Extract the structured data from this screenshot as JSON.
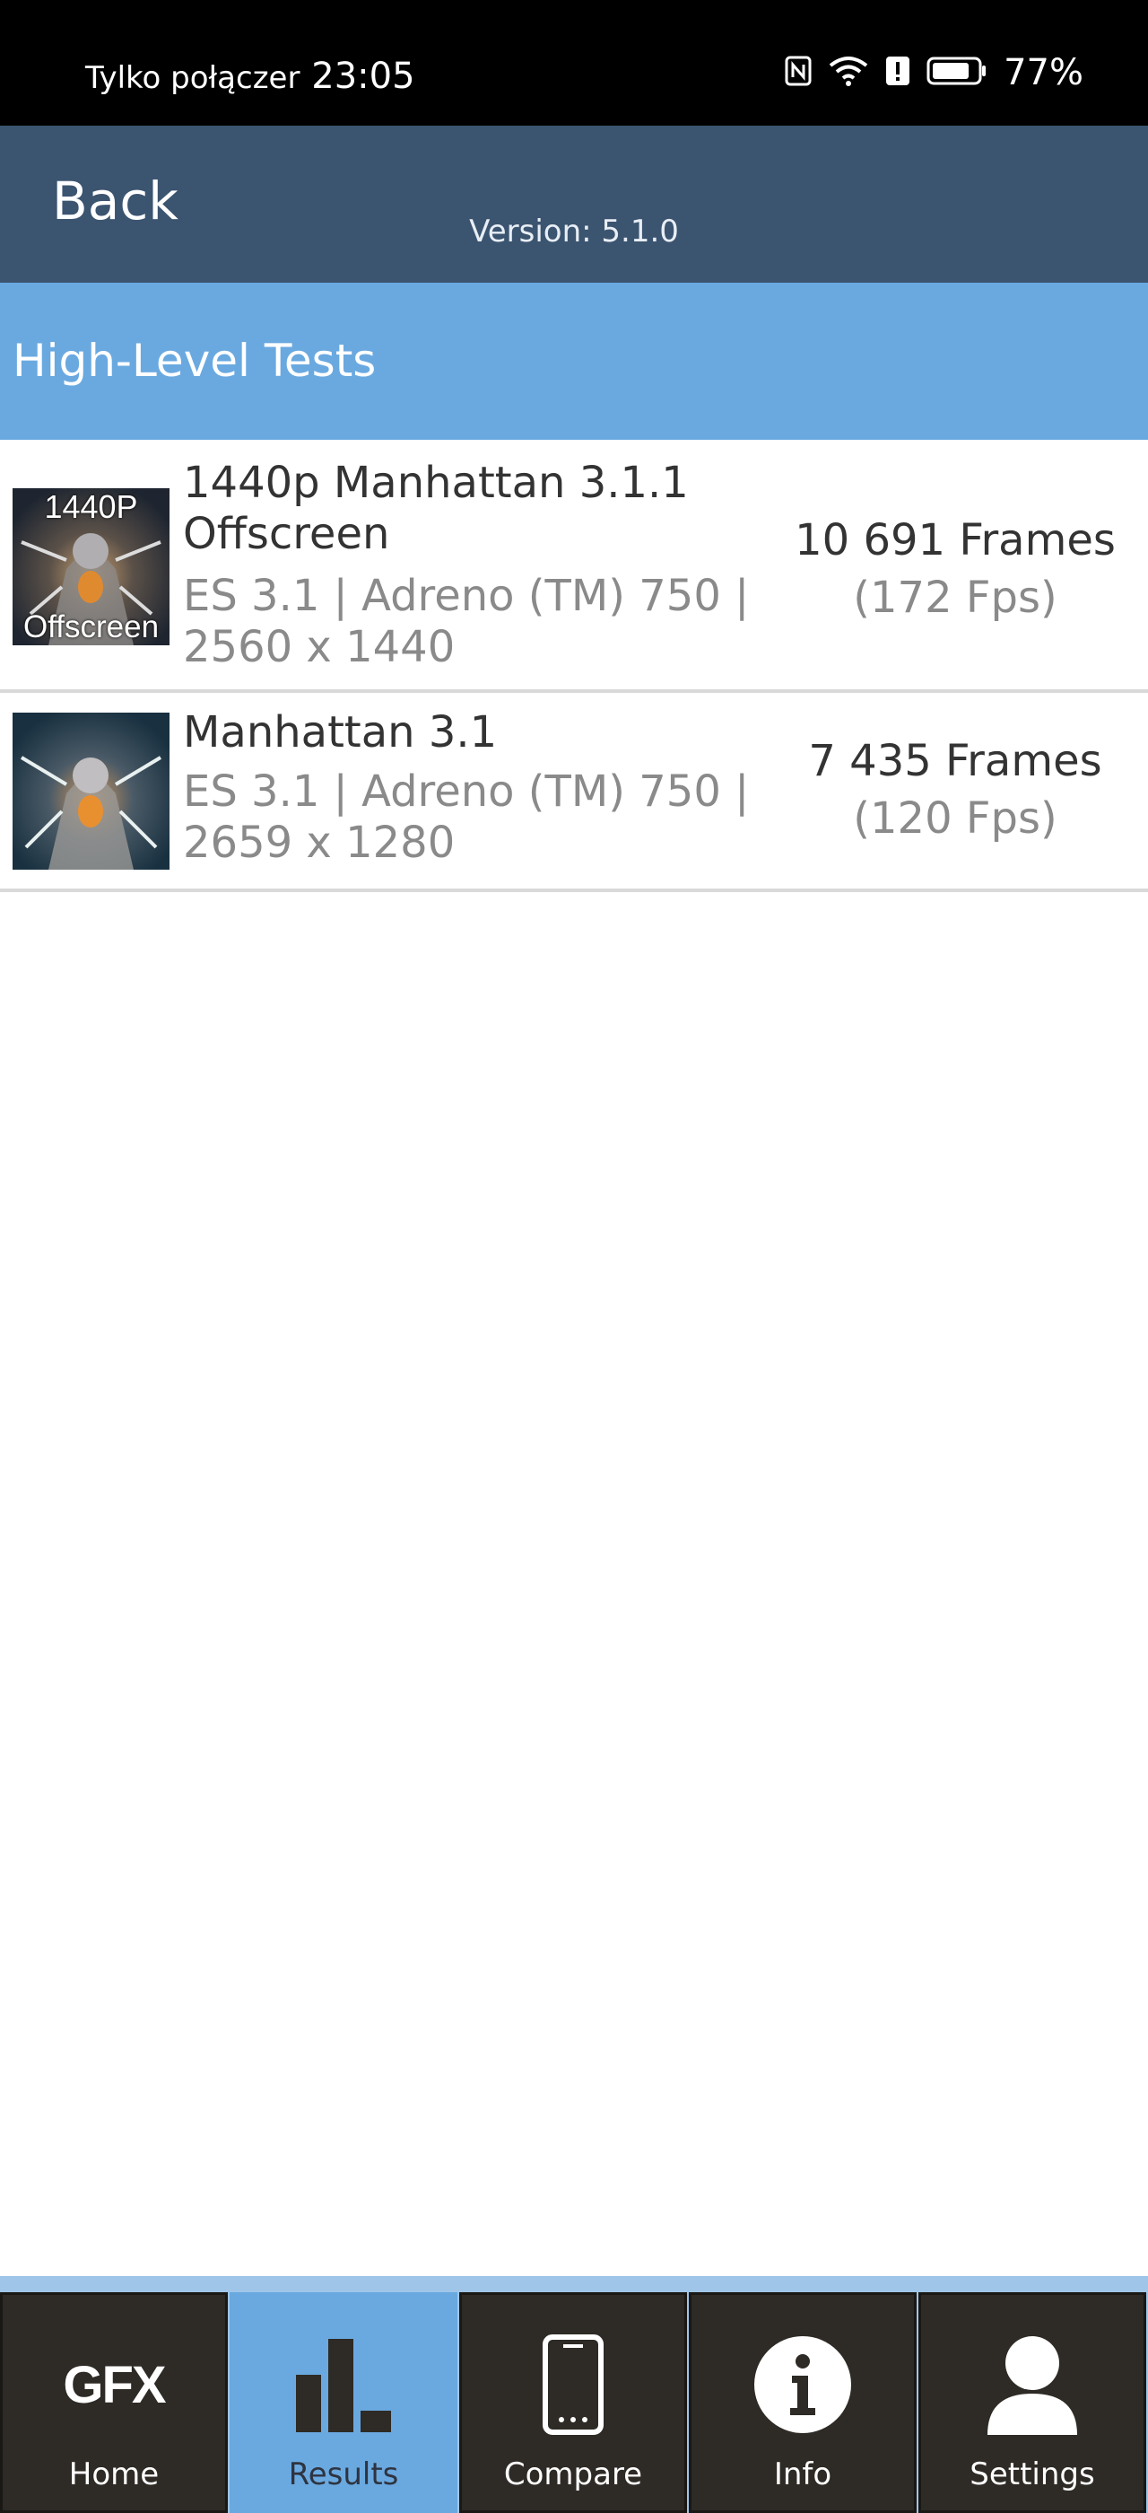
{
  "status_bar": {
    "carrier": "Tylko połączer",
    "time": "23:05",
    "battery_percent": "77%",
    "icons": [
      "nfc-icon",
      "wifi-icon",
      "alert-icon",
      "battery-icon"
    ]
  },
  "header": {
    "back_label": "Back",
    "version": "Version: 5.1.0"
  },
  "section": {
    "title": "High-Level Tests"
  },
  "results": [
    {
      "thumb_top": "1440P",
      "thumb_bottom": "Offscreen",
      "name": "1440p Manhattan 3.1.1 Offscreen",
      "details": "ES 3.1 | Adreno (TM) 750 | 2560 x 1440",
      "frames": "10 691 Frames",
      "fps": "(172 Fps)"
    },
    {
      "name": "Manhattan 3.1",
      "details": "ES 3.1 | Adreno (TM) 750 | 2659 x 1280",
      "frames": "7 435 Frames",
      "fps": "(120 Fps)"
    }
  ],
  "bottom_nav": {
    "active": "Results",
    "items": [
      {
        "label": "Home",
        "logo": "GFX",
        "icon": "gfx-logo"
      },
      {
        "label": "Results",
        "icon": "bar-chart-icon"
      },
      {
        "label": "Compare",
        "icon": "phone-icon"
      },
      {
        "label": "Info",
        "icon": "info-icon"
      },
      {
        "label": "Settings",
        "icon": "user-icon"
      }
    ]
  },
  "colors": {
    "status_bar": "#000000",
    "top_bar": "#3b5470",
    "section_header": "#6aa9e0",
    "nav_bg": "#2e2a25",
    "nav_active": "#6aa9e0"
  }
}
